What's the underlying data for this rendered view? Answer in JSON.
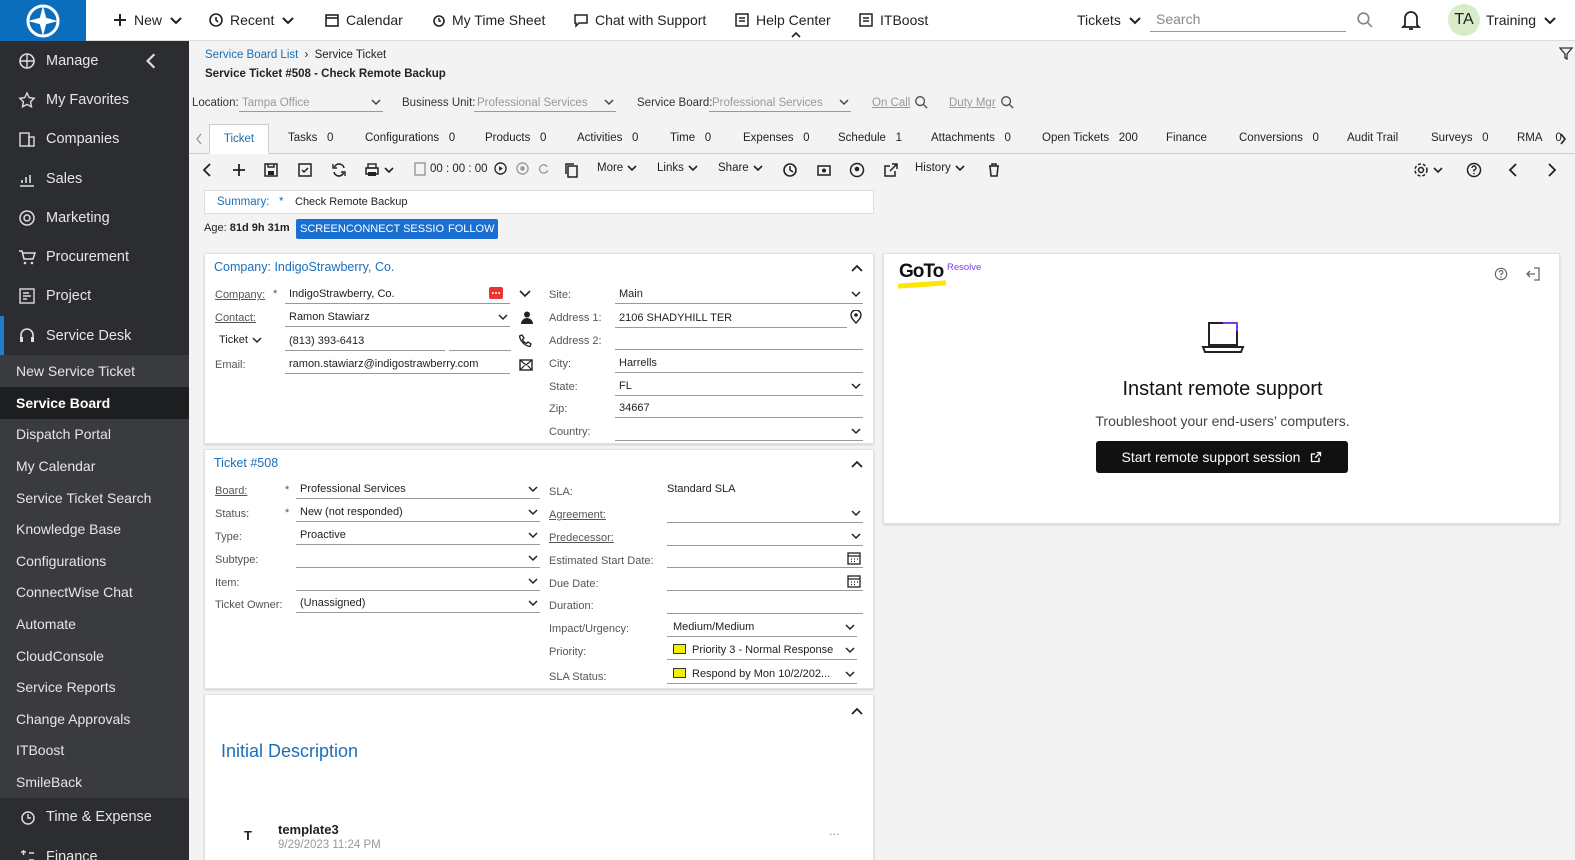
{
  "topbar": {
    "new": "New",
    "recent": "Recent",
    "calendar": "Calendar",
    "timesheet": "My Time Sheet",
    "chat": "Chat with Support",
    "help": "Help Center",
    "itboost": "ITBoost",
    "tickets": "Tickets",
    "search_placeholder": "Search",
    "avatar": "TA",
    "user": "Training"
  },
  "sidebar": {
    "manage": "Manage",
    "main_items": [
      "My Favorites",
      "Companies",
      "Sales",
      "Marketing",
      "Procurement",
      "Project",
      "Service Desk"
    ],
    "sub_items": [
      "New Service Ticket",
      "Service Board",
      "Dispatch Portal",
      "My Calendar",
      "Service Ticket Search",
      "Knowledge Base",
      "Configurations",
      "ConnectWise Chat",
      "Automate",
      "CloudConsole",
      "Service Reports",
      "Change Approvals",
      "ITBoost",
      "SmileBack"
    ],
    "time_expense": "Time & Expense",
    "finance": "Finance"
  },
  "breadcrumb": {
    "link": "Service Board List",
    "current": "Service Ticket",
    "title": "Service Ticket #508 - Check Remote Backup"
  },
  "filters": {
    "location_label": "Location:",
    "location_value": "Tampa Office",
    "bu_label": "Business Unit:",
    "bu_value": "Professional Services",
    "board_label": "Service Board:",
    "board_value": "Professional Services",
    "on_call": "On Call",
    "duty_mgr": "Duty Mgr"
  },
  "tabs": [
    {
      "label": "Ticket",
      "count": ""
    },
    {
      "label": "Tasks",
      "count": "0"
    },
    {
      "label": "Configurations",
      "count": "0"
    },
    {
      "label": "Products",
      "count": "0"
    },
    {
      "label": "Activities",
      "count": "0"
    },
    {
      "label": "Time",
      "count": "0"
    },
    {
      "label": "Expenses",
      "count": "0"
    },
    {
      "label": "Schedule",
      "count": "1"
    },
    {
      "label": "Attachments",
      "count": "0"
    },
    {
      "label": "Open Tickets",
      "count": "200"
    },
    {
      "label": "Finance",
      "count": ""
    },
    {
      "label": "Conversions",
      "count": "0"
    },
    {
      "label": "Audit Trail",
      "count": ""
    },
    {
      "label": "Surveys",
      "count": "0"
    },
    {
      "label": "RMA",
      "count": "0"
    }
  ],
  "toolbar": {
    "timer": "00 : 00 : 00",
    "more": "More",
    "links": "Links",
    "share": "Share",
    "history": "History"
  },
  "summary": {
    "label": "Summary:",
    "required": "*",
    "value": "Check Remote Backup",
    "age_label": "Age:",
    "age_value": "81d 9h 31m",
    "screenconnect": "SCREENCONNECT SESSION",
    "follow": "FOLLOW"
  },
  "company_panel": {
    "header": "Company: IndigoStrawberry, Co.",
    "company_label": "Company:",
    "company_value": "IndigoStrawberry, Co.",
    "contact_label": "Contact:",
    "contact_value": "Ramon Stawiarz",
    "phone_type": "Ticket",
    "phone_value": "(813) 393-6413",
    "email_label": "Email:",
    "email_value": "ramon.stawiarz@indigostrawberry.com",
    "site_label": "Site:",
    "site_value": "Main",
    "addr1_label": "Address 1:",
    "addr1_value": "2106 SHADYHILL TER",
    "addr2_label": "Address 2:",
    "city_label": "City:",
    "city_value": "Harrells",
    "state_label": "State:",
    "state_value": "FL",
    "zip_label": "Zip:",
    "zip_value": "34667",
    "country_label": "Country:"
  },
  "ticket_panel": {
    "header": "Ticket #508",
    "board_label": "Board:",
    "board_value": "Professional Services",
    "status_label": "Status:",
    "status_value": "New (not responded)",
    "type_label": "Type:",
    "type_value": "Proactive",
    "subtype_label": "Subtype:",
    "item_label": "Item:",
    "owner_label": "Ticket Owner:",
    "owner_value": "(Unassigned)",
    "sla_label": "SLA:",
    "sla_value": "Standard SLA",
    "agreement_label": "Agreement:",
    "predecessor_label": "Predecessor:",
    "est_start_label": "Estimated Start Date:",
    "due_label": "Due Date:",
    "duration_label": "Duration:",
    "impact_label": "Impact/Urgency:",
    "impact_value": "Medium/Medium",
    "priority_label": "Priority:",
    "priority_value": "Priority 3 - Normal Response",
    "sla_status_label": "SLA Status:",
    "sla_status_value": "Respond by Mon 10/2/202..."
  },
  "description": {
    "title": "Initial Description",
    "author_initial": "T",
    "author": "template3",
    "date": "9/29/2023 11:24 PM",
    "more": "..."
  },
  "goto": {
    "logo": "GoTo",
    "resolve": "Resolve",
    "heading": "Instant remote support",
    "sub": "Troubleshoot your end-users’ computers.",
    "button": "Start remote support session"
  },
  "colors": {
    "brand_blue": "#1b6fb8",
    "sidebar_bg": "#2b2d30",
    "priority_yellow": "#f5ef00"
  }
}
